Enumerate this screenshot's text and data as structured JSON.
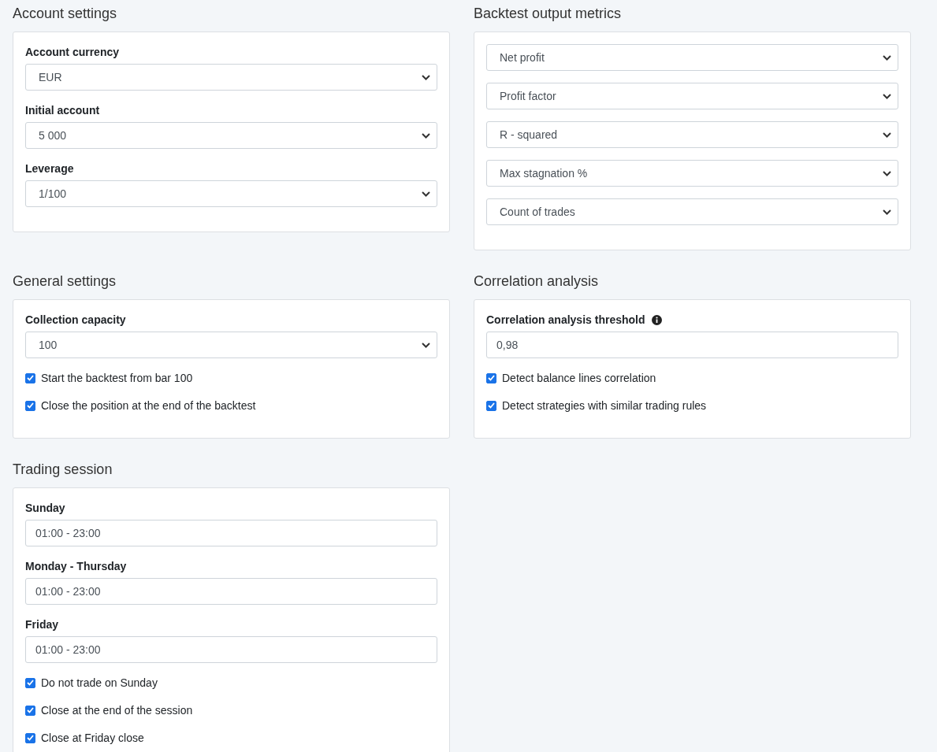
{
  "rows": [
    [
      {
        "title": "Account settings",
        "items": [
          {
            "kind": "select",
            "label": "Account currency",
            "value": "EUR"
          },
          {
            "kind": "select",
            "label": "Initial account",
            "value": "5 000"
          },
          {
            "kind": "select",
            "label": "Leverage",
            "value": "1/100"
          }
        ]
      },
      {
        "title": "Backtest output metrics",
        "items": [
          {
            "kind": "select",
            "value": "Net profit"
          },
          {
            "kind": "select",
            "value": "Profit factor"
          },
          {
            "kind": "select",
            "value": "R - squared"
          },
          {
            "kind": "select",
            "value": "Max stagnation %"
          },
          {
            "kind": "select",
            "value": "Count of trades"
          }
        ]
      }
    ],
    [
      {
        "title": "General settings",
        "items": [
          {
            "kind": "select",
            "label": "Collection capacity",
            "value": "100"
          },
          {
            "kind": "checkbox",
            "label": "Start the backtest from bar 100",
            "checked": true
          },
          {
            "kind": "checkbox",
            "label": "Close the position at the end of the backtest",
            "checked": true
          }
        ]
      },
      {
        "title": "Correlation analysis",
        "items": [
          {
            "kind": "input",
            "label": "Correlation analysis threshold",
            "info": true,
            "value": "0,98"
          },
          {
            "kind": "checkbox",
            "label": "Detect balance lines correlation",
            "checked": true
          },
          {
            "kind": "checkbox",
            "label": "Detect strategies with similar trading rules",
            "checked": true
          }
        ]
      }
    ],
    [
      {
        "title": "Trading session",
        "items": [
          {
            "kind": "input",
            "label": "Sunday",
            "value": "01:00 - 23:00"
          },
          {
            "kind": "input",
            "label": "Monday - Thursday",
            "value": "01:00 - 23:00"
          },
          {
            "kind": "input",
            "label": "Friday",
            "value": "01:00 - 23:00"
          },
          {
            "kind": "checkbox",
            "label": "Do not trade on Sunday",
            "checked": true
          },
          {
            "kind": "checkbox",
            "label": "Close at the end of the session",
            "checked": true
          },
          {
            "kind": "checkbox",
            "label": "Close at Friday close",
            "checked": true
          }
        ]
      }
    ]
  ]
}
